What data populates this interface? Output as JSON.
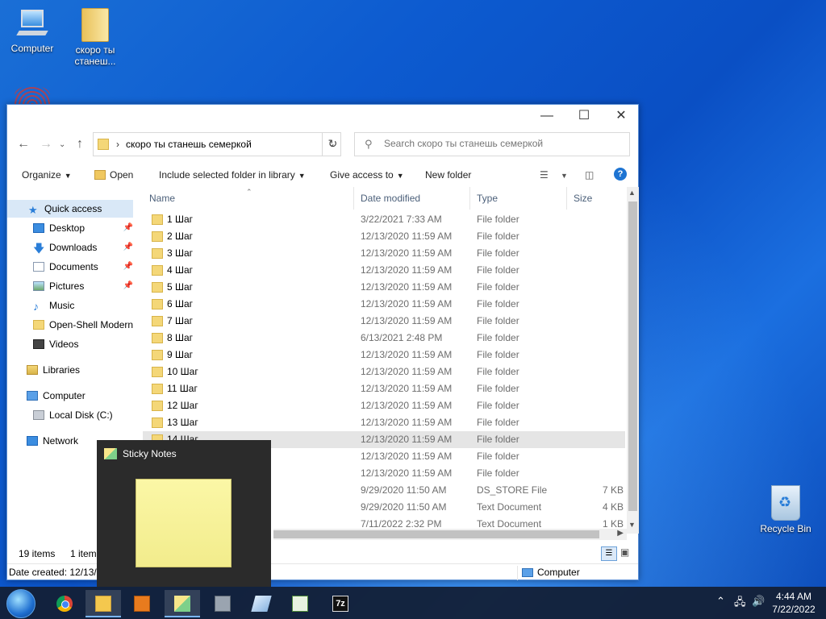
{
  "desktop": {
    "icons": [
      {
        "label": "Computer"
      },
      {
        "label": "скоро ты станеш..."
      },
      {
        "label": "Recycle Bin"
      }
    ]
  },
  "explorer": {
    "address": {
      "path": "скоро ты станешь семеркой"
    },
    "search": {
      "placeholder": "Search скоро ты станешь семеркой"
    },
    "toolbar": {
      "organize": "Organize",
      "open": "Open",
      "include": "Include selected folder in library",
      "give_access": "Give access to",
      "new_folder": "New folder"
    },
    "nav": {
      "quick_access": "Quick access",
      "desktop": "Desktop",
      "downloads": "Downloads",
      "documents": "Documents",
      "pictures": "Pictures",
      "music": "Music",
      "openshell": "Open-Shell Modern",
      "videos": "Videos",
      "libraries": "Libraries",
      "computer": "Computer",
      "local_disk": "Local Disk (C:)",
      "network": "Network"
    },
    "columns": {
      "name": "Name",
      "date": "Date modified",
      "type": "Type",
      "size": "Size"
    },
    "files": [
      {
        "name": "1 Шаг",
        "date": "3/22/2021 7:33 AM",
        "type": "File folder",
        "size": ""
      },
      {
        "name": "2 Шаг",
        "date": "12/13/2020 11:59 AM",
        "type": "File folder",
        "size": ""
      },
      {
        "name": "3 Шаг",
        "date": "12/13/2020 11:59 AM",
        "type": "File folder",
        "size": ""
      },
      {
        "name": "4 Шаг",
        "date": "12/13/2020 11:59 AM",
        "type": "File folder",
        "size": ""
      },
      {
        "name": "5 Шаг",
        "date": "12/13/2020 11:59 AM",
        "type": "File folder",
        "size": ""
      },
      {
        "name": "6 Шаг",
        "date": "12/13/2020 11:59 AM",
        "type": "File folder",
        "size": ""
      },
      {
        "name": "7 Шаг",
        "date": "12/13/2020 11:59 AM",
        "type": "File folder",
        "size": ""
      },
      {
        "name": "8 Шаг",
        "date": "6/13/2021 2:48 PM",
        "type": "File folder",
        "size": ""
      },
      {
        "name": "9 Шаг",
        "date": "12/13/2020 11:59 AM",
        "type": "File folder",
        "size": ""
      },
      {
        "name": "10 Шаг",
        "date": "12/13/2020 11:59 AM",
        "type": "File folder",
        "size": ""
      },
      {
        "name": "11 Шаг",
        "date": "12/13/2020 11:59 AM",
        "type": "File folder",
        "size": ""
      },
      {
        "name": "12 Шаг",
        "date": "12/13/2020 11:59 AM",
        "type": "File folder",
        "size": ""
      },
      {
        "name": "13 Шаг",
        "date": "12/13/2020 11:59 AM",
        "type": "File folder",
        "size": ""
      },
      {
        "name": "14 Шаг",
        "date": "12/13/2020 11:59 AM",
        "type": "File folder",
        "size": ""
      },
      {
        "name": "",
        "date": "12/13/2020 11:59 AM",
        "type": "File folder",
        "size": ""
      },
      {
        "name": "",
        "date": "12/13/2020 11:59 AM",
        "type": "File folder",
        "size": ""
      },
      {
        "name": "",
        "date": "9/29/2020 11:50 AM",
        "type": "DS_STORE File",
        "size": "7 KB"
      },
      {
        "name": "",
        "date": "9/29/2020 11:50 AM",
        "type": "Text Document",
        "size": "4 KB"
      },
      {
        "name": "",
        "date": "7/11/2022 2:32 PM",
        "type": "Text Document",
        "size": "1 KB"
      }
    ],
    "status": {
      "items": "19 items",
      "selected": "1 item"
    },
    "details": {
      "date_created": "Date created: 12/13/2022",
      "location": "Computer"
    }
  },
  "sticky_popup": {
    "title": "Sticky Notes"
  },
  "taskbar": {
    "apps": [
      "start-icon",
      "chrome-icon",
      "file-explorer-icon",
      "media-player-icon",
      "sticky-notes-icon",
      "network-tool-icon",
      "paper-icon",
      "chart-app-icon",
      "7zip-icon"
    ],
    "sevenzip_label": "7z",
    "clock": {
      "time": "4:44 AM",
      "date": "7/22/2022"
    }
  }
}
